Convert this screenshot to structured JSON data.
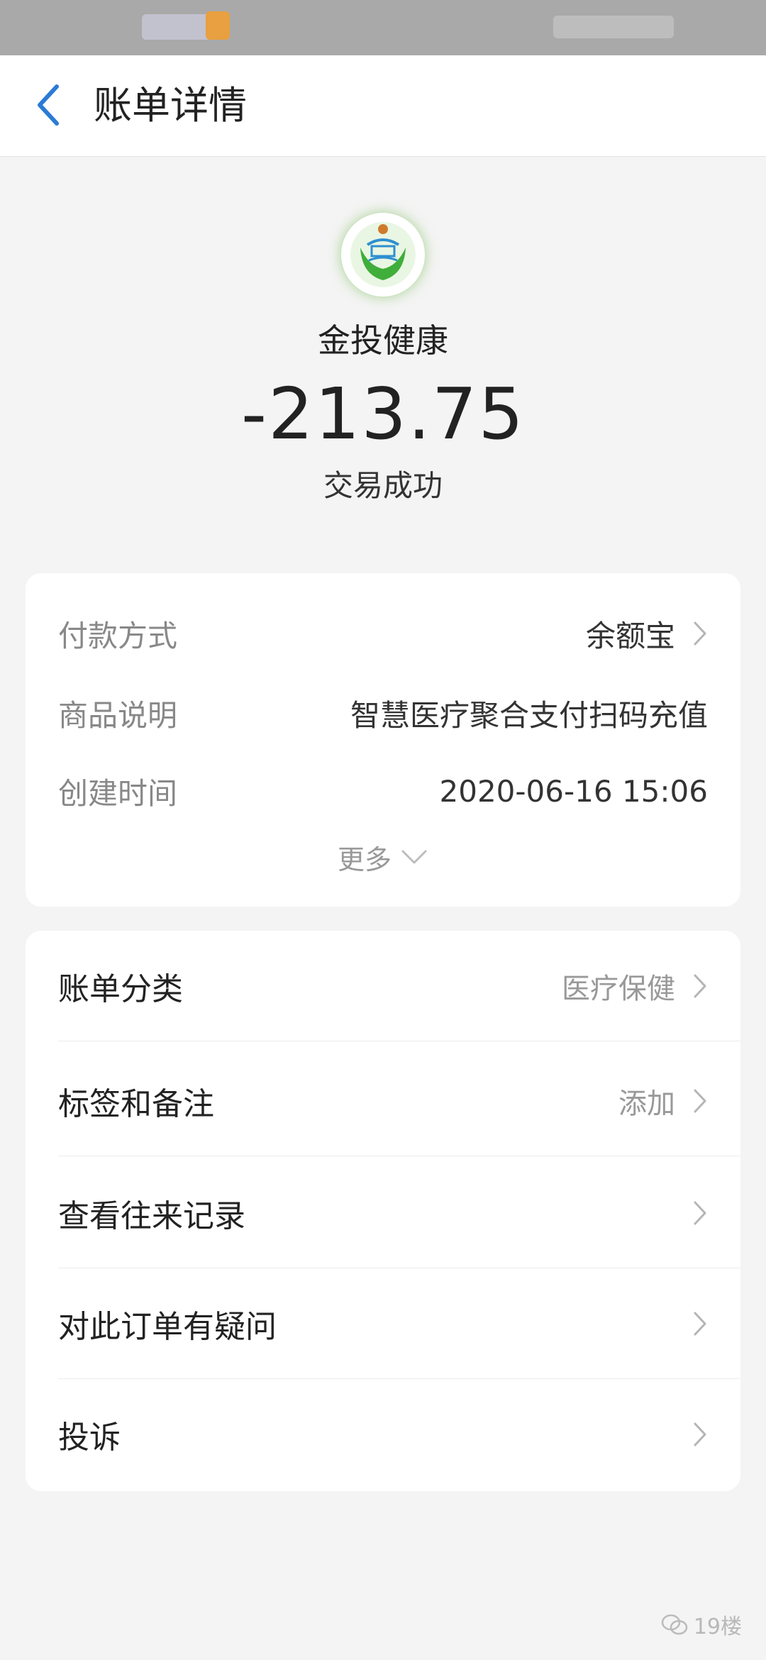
{
  "nav": {
    "title": "账单详情"
  },
  "merchant": {
    "name": "金投健康",
    "amount": "-213.75",
    "status": "交易成功"
  },
  "details": {
    "rows": [
      {
        "label": "付款方式",
        "value": "余额宝",
        "has_chevron": true
      },
      {
        "label": "商品说明",
        "value": "智慧医疗聚合支付扫码充值",
        "has_chevron": false
      },
      {
        "label": "创建时间",
        "value": "2020-06-16 15:06",
        "has_chevron": false
      }
    ],
    "more_label": "更多"
  },
  "actions": [
    {
      "label": "账单分类",
      "value": "医疗保健"
    },
    {
      "label": "标签和备注",
      "value": "添加"
    },
    {
      "label": "查看往来记录",
      "value": ""
    },
    {
      "label": "对此订单有疑问",
      "value": ""
    },
    {
      "label": "投诉",
      "value": ""
    }
  ],
  "watermark": {
    "text": "19楼"
  },
  "colors": {
    "accent_blue": "#2b7bd6",
    "logo_green": "#3fae3a",
    "status_bar": "#a9a9a9",
    "background": "#f4f4f4"
  }
}
